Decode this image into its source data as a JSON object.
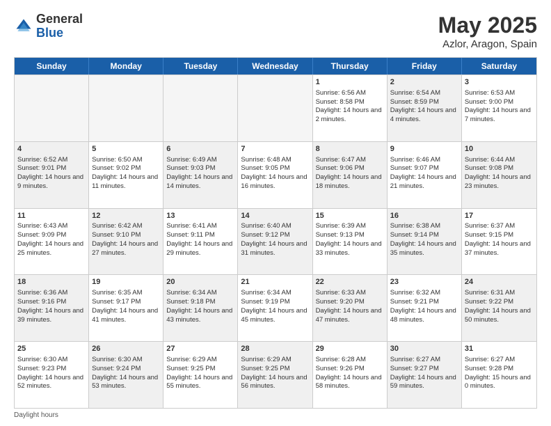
{
  "logo": {
    "general": "General",
    "blue": "Blue"
  },
  "title": {
    "month": "May 2025",
    "location": "Azlor, Aragon, Spain"
  },
  "header_days": [
    "Sunday",
    "Monday",
    "Tuesday",
    "Wednesday",
    "Thursday",
    "Friday",
    "Saturday"
  ],
  "weeks": [
    [
      {
        "day": "",
        "sunrise": "",
        "sunset": "",
        "daylight": "",
        "shaded": true
      },
      {
        "day": "",
        "sunrise": "",
        "sunset": "",
        "daylight": "",
        "shaded": true
      },
      {
        "day": "",
        "sunrise": "",
        "sunset": "",
        "daylight": "",
        "shaded": true
      },
      {
        "day": "",
        "sunrise": "",
        "sunset": "",
        "daylight": "",
        "shaded": true
      },
      {
        "day": "1",
        "sunrise": "Sunrise: 6:56 AM",
        "sunset": "Sunset: 8:58 PM",
        "daylight": "Daylight: 14 hours and 2 minutes.",
        "shaded": false
      },
      {
        "day": "2",
        "sunrise": "Sunrise: 6:54 AM",
        "sunset": "Sunset: 8:59 PM",
        "daylight": "Daylight: 14 hours and 4 minutes.",
        "shaded": true
      },
      {
        "day": "3",
        "sunrise": "Sunrise: 6:53 AM",
        "sunset": "Sunset: 9:00 PM",
        "daylight": "Daylight: 14 hours and 7 minutes.",
        "shaded": false
      }
    ],
    [
      {
        "day": "4",
        "sunrise": "Sunrise: 6:52 AM",
        "sunset": "Sunset: 9:01 PM",
        "daylight": "Daylight: 14 hours and 9 minutes.",
        "shaded": true
      },
      {
        "day": "5",
        "sunrise": "Sunrise: 6:50 AM",
        "sunset": "Sunset: 9:02 PM",
        "daylight": "Daylight: 14 hours and 11 minutes.",
        "shaded": false
      },
      {
        "day": "6",
        "sunrise": "Sunrise: 6:49 AM",
        "sunset": "Sunset: 9:03 PM",
        "daylight": "Daylight: 14 hours and 14 minutes.",
        "shaded": true
      },
      {
        "day": "7",
        "sunrise": "Sunrise: 6:48 AM",
        "sunset": "Sunset: 9:05 PM",
        "daylight": "Daylight: 14 hours and 16 minutes.",
        "shaded": false
      },
      {
        "day": "8",
        "sunrise": "Sunrise: 6:47 AM",
        "sunset": "Sunset: 9:06 PM",
        "daylight": "Daylight: 14 hours and 18 minutes.",
        "shaded": true
      },
      {
        "day": "9",
        "sunrise": "Sunrise: 6:46 AM",
        "sunset": "Sunset: 9:07 PM",
        "daylight": "Daylight: 14 hours and 21 minutes.",
        "shaded": false
      },
      {
        "day": "10",
        "sunrise": "Sunrise: 6:44 AM",
        "sunset": "Sunset: 9:08 PM",
        "daylight": "Daylight: 14 hours and 23 minutes.",
        "shaded": true
      }
    ],
    [
      {
        "day": "11",
        "sunrise": "Sunrise: 6:43 AM",
        "sunset": "Sunset: 9:09 PM",
        "daylight": "Daylight: 14 hours and 25 minutes.",
        "shaded": false
      },
      {
        "day": "12",
        "sunrise": "Sunrise: 6:42 AM",
        "sunset": "Sunset: 9:10 PM",
        "daylight": "Daylight: 14 hours and 27 minutes.",
        "shaded": true
      },
      {
        "day": "13",
        "sunrise": "Sunrise: 6:41 AM",
        "sunset": "Sunset: 9:11 PM",
        "daylight": "Daylight: 14 hours and 29 minutes.",
        "shaded": false
      },
      {
        "day": "14",
        "sunrise": "Sunrise: 6:40 AM",
        "sunset": "Sunset: 9:12 PM",
        "daylight": "Daylight: 14 hours and 31 minutes.",
        "shaded": true
      },
      {
        "day": "15",
        "sunrise": "Sunrise: 6:39 AM",
        "sunset": "Sunset: 9:13 PM",
        "daylight": "Daylight: 14 hours and 33 minutes.",
        "shaded": false
      },
      {
        "day": "16",
        "sunrise": "Sunrise: 6:38 AM",
        "sunset": "Sunset: 9:14 PM",
        "daylight": "Daylight: 14 hours and 35 minutes.",
        "shaded": true
      },
      {
        "day": "17",
        "sunrise": "Sunrise: 6:37 AM",
        "sunset": "Sunset: 9:15 PM",
        "daylight": "Daylight: 14 hours and 37 minutes.",
        "shaded": false
      }
    ],
    [
      {
        "day": "18",
        "sunrise": "Sunrise: 6:36 AM",
        "sunset": "Sunset: 9:16 PM",
        "daylight": "Daylight: 14 hours and 39 minutes.",
        "shaded": true
      },
      {
        "day": "19",
        "sunrise": "Sunrise: 6:35 AM",
        "sunset": "Sunset: 9:17 PM",
        "daylight": "Daylight: 14 hours and 41 minutes.",
        "shaded": false
      },
      {
        "day": "20",
        "sunrise": "Sunrise: 6:34 AM",
        "sunset": "Sunset: 9:18 PM",
        "daylight": "Daylight: 14 hours and 43 minutes.",
        "shaded": true
      },
      {
        "day": "21",
        "sunrise": "Sunrise: 6:34 AM",
        "sunset": "Sunset: 9:19 PM",
        "daylight": "Daylight: 14 hours and 45 minutes.",
        "shaded": false
      },
      {
        "day": "22",
        "sunrise": "Sunrise: 6:33 AM",
        "sunset": "Sunset: 9:20 PM",
        "daylight": "Daylight: 14 hours and 47 minutes.",
        "shaded": true
      },
      {
        "day": "23",
        "sunrise": "Sunrise: 6:32 AM",
        "sunset": "Sunset: 9:21 PM",
        "daylight": "Daylight: 14 hours and 48 minutes.",
        "shaded": false
      },
      {
        "day": "24",
        "sunrise": "Sunrise: 6:31 AM",
        "sunset": "Sunset: 9:22 PM",
        "daylight": "Daylight: 14 hours and 50 minutes.",
        "shaded": true
      }
    ],
    [
      {
        "day": "25",
        "sunrise": "Sunrise: 6:30 AM",
        "sunset": "Sunset: 9:23 PM",
        "daylight": "Daylight: 14 hours and 52 minutes.",
        "shaded": false
      },
      {
        "day": "26",
        "sunrise": "Sunrise: 6:30 AM",
        "sunset": "Sunset: 9:24 PM",
        "daylight": "Daylight: 14 hours and 53 minutes.",
        "shaded": true
      },
      {
        "day": "27",
        "sunrise": "Sunrise: 6:29 AM",
        "sunset": "Sunset: 9:25 PM",
        "daylight": "Daylight: 14 hours and 55 minutes.",
        "shaded": false
      },
      {
        "day": "28",
        "sunrise": "Sunrise: 6:29 AM",
        "sunset": "Sunset: 9:25 PM",
        "daylight": "Daylight: 14 hours and 56 minutes.",
        "shaded": true
      },
      {
        "day": "29",
        "sunrise": "Sunrise: 6:28 AM",
        "sunset": "Sunset: 9:26 PM",
        "daylight": "Daylight: 14 hours and 58 minutes.",
        "shaded": false
      },
      {
        "day": "30",
        "sunrise": "Sunrise: 6:27 AM",
        "sunset": "Sunset: 9:27 PM",
        "daylight": "Daylight: 14 hours and 59 minutes.",
        "shaded": true
      },
      {
        "day": "31",
        "sunrise": "Sunrise: 6:27 AM",
        "sunset": "Sunset: 9:28 PM",
        "daylight": "Daylight: 15 hours and 0 minutes.",
        "shaded": false
      }
    ]
  ],
  "footer": "Daylight hours"
}
